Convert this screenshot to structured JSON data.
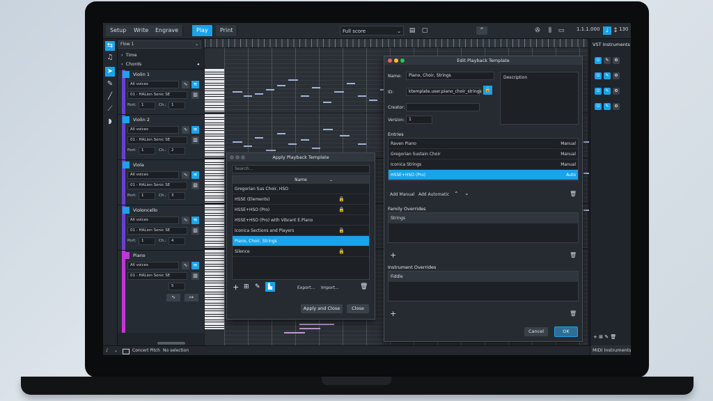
{
  "topbar": {
    "modes": [
      "Setup",
      "Write",
      "Engrave",
      "Play",
      "Print"
    ],
    "active_mode": "Play",
    "layout_selector": "Full score",
    "timecode": "1.1.1.000",
    "tempo": "130"
  },
  "flow_selector": "Flow 1",
  "global_tracks": [
    "Time",
    "Chords"
  ],
  "tracks": [
    {
      "name": "Violin 1",
      "voices": "All voices",
      "instrument": "01 - HALion Sonic SE",
      "port": "1",
      "channel": "1"
    },
    {
      "name": "Violin 2",
      "voices": "All voices",
      "instrument": "01 - HALion Sonic SE",
      "port": "1",
      "channel": "2"
    },
    {
      "name": "Viola",
      "voices": "All voices",
      "instrument": "01 - HALion Sonic SE",
      "port": "1",
      "channel": "3"
    },
    {
      "name": "Violoncello",
      "voices": "All voices",
      "instrument": "01 - HALion Sonic SE",
      "port": "1",
      "channel": "4"
    },
    {
      "name": "Piano",
      "voices": "All voices",
      "instrument": "01 - HALion Sonic SE",
      "port": "",
      "channel": "5"
    }
  ],
  "track_labels": {
    "port": "Port:",
    "channel": "Ch.:"
  },
  "apply_dialog": {
    "title": "Apply Playback Template",
    "search_placeholder": "Search...",
    "column_header": "Name",
    "rows": [
      {
        "name": "Gregorian Sus Choir, HSO",
        "locked": false
      },
      {
        "name": "HSSE (Elements)",
        "locked": true
      },
      {
        "name": "HSSE+HSO (Pro)",
        "locked": true
      },
      {
        "name": "HSSE+HSO (Pro) with Vibrant E.Piano",
        "locked": false
      },
      {
        "name": "Iconica Sections and Players",
        "locked": true
      },
      {
        "name": "Piano, Choir, Strings",
        "locked": false
      },
      {
        "name": "Silence",
        "locked": true
      }
    ],
    "selected_index": 5,
    "export_label": "Export...",
    "import_label": "Import...",
    "apply_label": "Apply and Close",
    "close_label": "Close"
  },
  "edit_dialog": {
    "title": "Edit Playback Template",
    "name_label": "Name:",
    "name_value": "Piano, Choir, Strings",
    "id_label": "ID:",
    "id_value": "ktemplate.user.piano_choir_strings",
    "creator_label": "Creator:",
    "creator_value": "",
    "version_label": "Version:",
    "version_value": "1",
    "description_label": "Description",
    "entries_label": "Entries",
    "entries": [
      {
        "name": "Raven Piano",
        "type": "Manual"
      },
      {
        "name": "Gregorian Sustain Choir",
        "type": "Manual"
      },
      {
        "name": "Iconica Strings",
        "type": "Manual"
      },
      {
        "name": "HSSE+HSO (Pro)",
        "type": "Auto"
      }
    ],
    "selected_entry": 3,
    "add_manual_label": "Add Manual",
    "add_automatic_label": "Add Automatic",
    "family_overrides_label": "Family Overrides",
    "family_overrides": [
      "Strings"
    ],
    "instrument_overrides_label": "Instrument Overrides",
    "instrument_overrides": [
      "Fiddle"
    ],
    "cancel_label": "Cancel",
    "ok_label": "OK"
  },
  "right_panel": {
    "title": "VST Instruments",
    "bottom_title": "MIDI Instruments"
  },
  "status": {
    "concert_pitch": "Concert Pitch",
    "selection": "No selection"
  },
  "colors": {
    "accent": "#1aa3e8",
    "track_bar": "#6a3fd0",
    "piano_bar": "#c236d8",
    "logo_blue": "#3a2fd6",
    "logo_magenta": "#c236d8"
  }
}
